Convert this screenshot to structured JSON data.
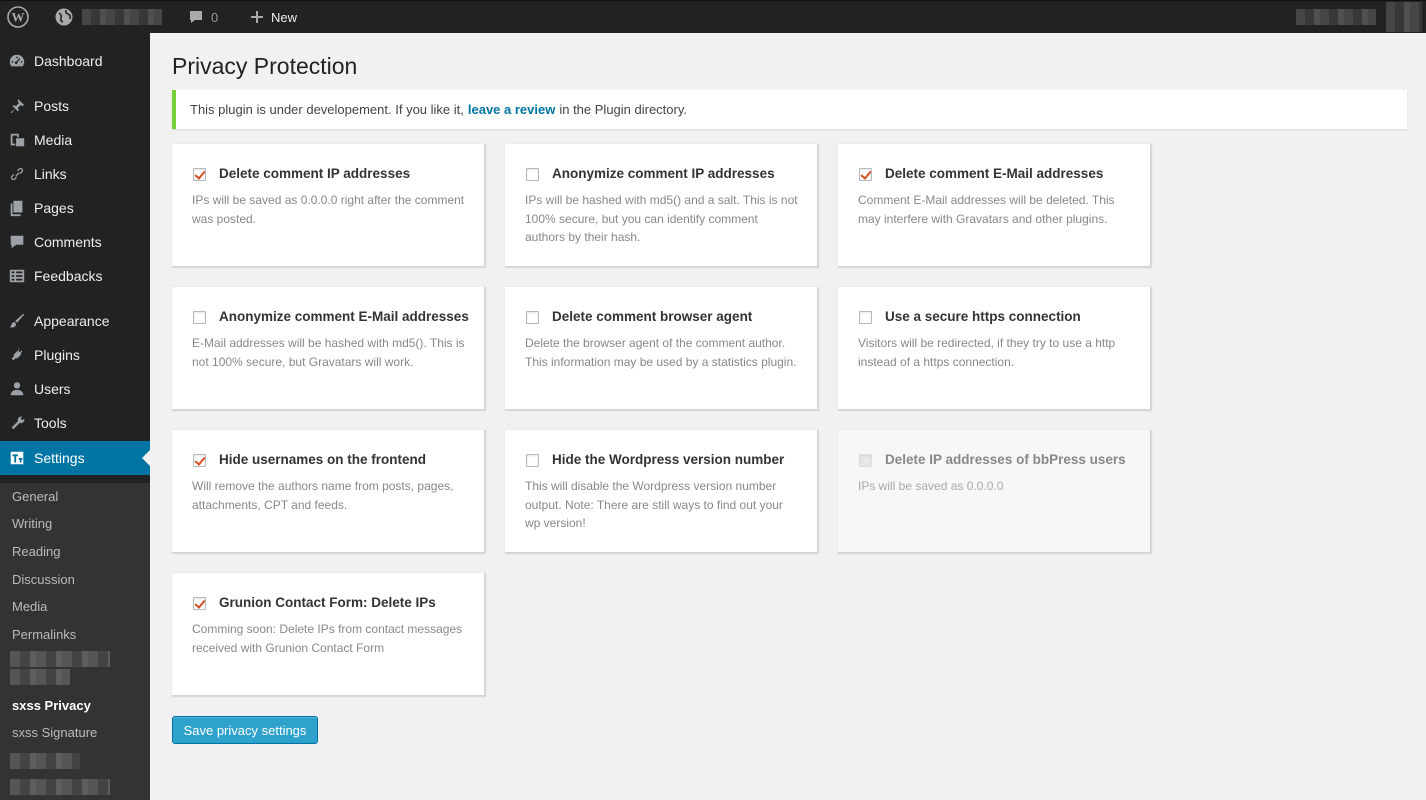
{
  "adminbar": {
    "comments_count": "0",
    "new_label": "New"
  },
  "sidebar": {
    "menu": [
      {
        "label": "Dashboard",
        "icon": "dashboard-icon"
      },
      {
        "label": "Posts",
        "icon": "pin-icon"
      },
      {
        "label": "Media",
        "icon": "media-icon"
      },
      {
        "label": "Links",
        "icon": "link-icon"
      },
      {
        "label": "Pages",
        "icon": "pages-icon"
      },
      {
        "label": "Comments",
        "icon": "comment-icon"
      },
      {
        "label": "Feedbacks",
        "icon": "feedback-icon"
      },
      {
        "label": "Appearance",
        "icon": "brush-icon"
      },
      {
        "label": "Plugins",
        "icon": "plugin-icon"
      },
      {
        "label": "Users",
        "icon": "user-icon"
      },
      {
        "label": "Tools",
        "icon": "wrench-icon"
      },
      {
        "label": "Settings",
        "icon": "settings-icon"
      }
    ],
    "submenu": [
      "General",
      "Writing",
      "Reading",
      "Discussion",
      "Media",
      "Permalinks",
      "sxss Privacy",
      "sxss Signature"
    ]
  },
  "main": {
    "title": "Privacy Protection",
    "notice": {
      "before": "This plugin is under developement. If you like it,",
      "link": "leave a review",
      "after": "in the Plugin directory."
    },
    "options": [
      {
        "title": "Delete comment IP addresses",
        "desc": "IPs will be saved as 0.0.0.0 right after the comment was posted.",
        "checked": true,
        "disabled": false
      },
      {
        "title": "Anonymize comment IP addresses",
        "desc": "IPs will be hashed with md5() and a salt. This is not 100% secure, but you can identify comment authors by their hash.",
        "checked": false,
        "disabled": false
      },
      {
        "title": "Delete comment E-Mail addresses",
        "desc": "Comment E-Mail addresses will be deleted. This may interfere with Gravatars and other plugins.",
        "checked": true,
        "disabled": false
      },
      {
        "title": "Anonymize comment E-Mail addresses",
        "desc": "E-Mail addresses will be hashed with md5(). This is not 100% secure, but Gravatars will work.",
        "checked": false,
        "disabled": false
      },
      {
        "title": "Delete comment browser agent",
        "desc": "Delete the browser agent of the comment author. This information may be used by a statistics plugin.",
        "checked": false,
        "disabled": false
      },
      {
        "title": "Use a secure https connection",
        "desc": "Visitors will be redirected, if they try to use a http instead of a https connection.",
        "checked": false,
        "disabled": false
      },
      {
        "title": "Hide usernames on the frontend",
        "desc": "Will remove the authors name from posts, pages, attachments, CPT and feeds.",
        "checked": true,
        "disabled": false
      },
      {
        "title": "Hide the Wordpress version number",
        "desc": "This will disable the Wordpress version number output. Note: There are still ways to find out your wp version!",
        "checked": false,
        "disabled": false
      },
      {
        "title": "Delete IP addresses of bbPress users",
        "desc": "IPs will be saved as 0.0.0.0",
        "checked": false,
        "disabled": true
      },
      {
        "title": "Grunion Contact Form: Delete IPs",
        "desc": "Comming soon: Delete IPs from contact messages received with Grunion Contact Form",
        "checked": true,
        "disabled": false
      }
    ],
    "save_label": "Save privacy settings"
  },
  "colors": {
    "accent": "#0074a2",
    "checkmark": "#d54e21",
    "notice_border": "#7ad03a",
    "button": "#2ea2cc"
  }
}
